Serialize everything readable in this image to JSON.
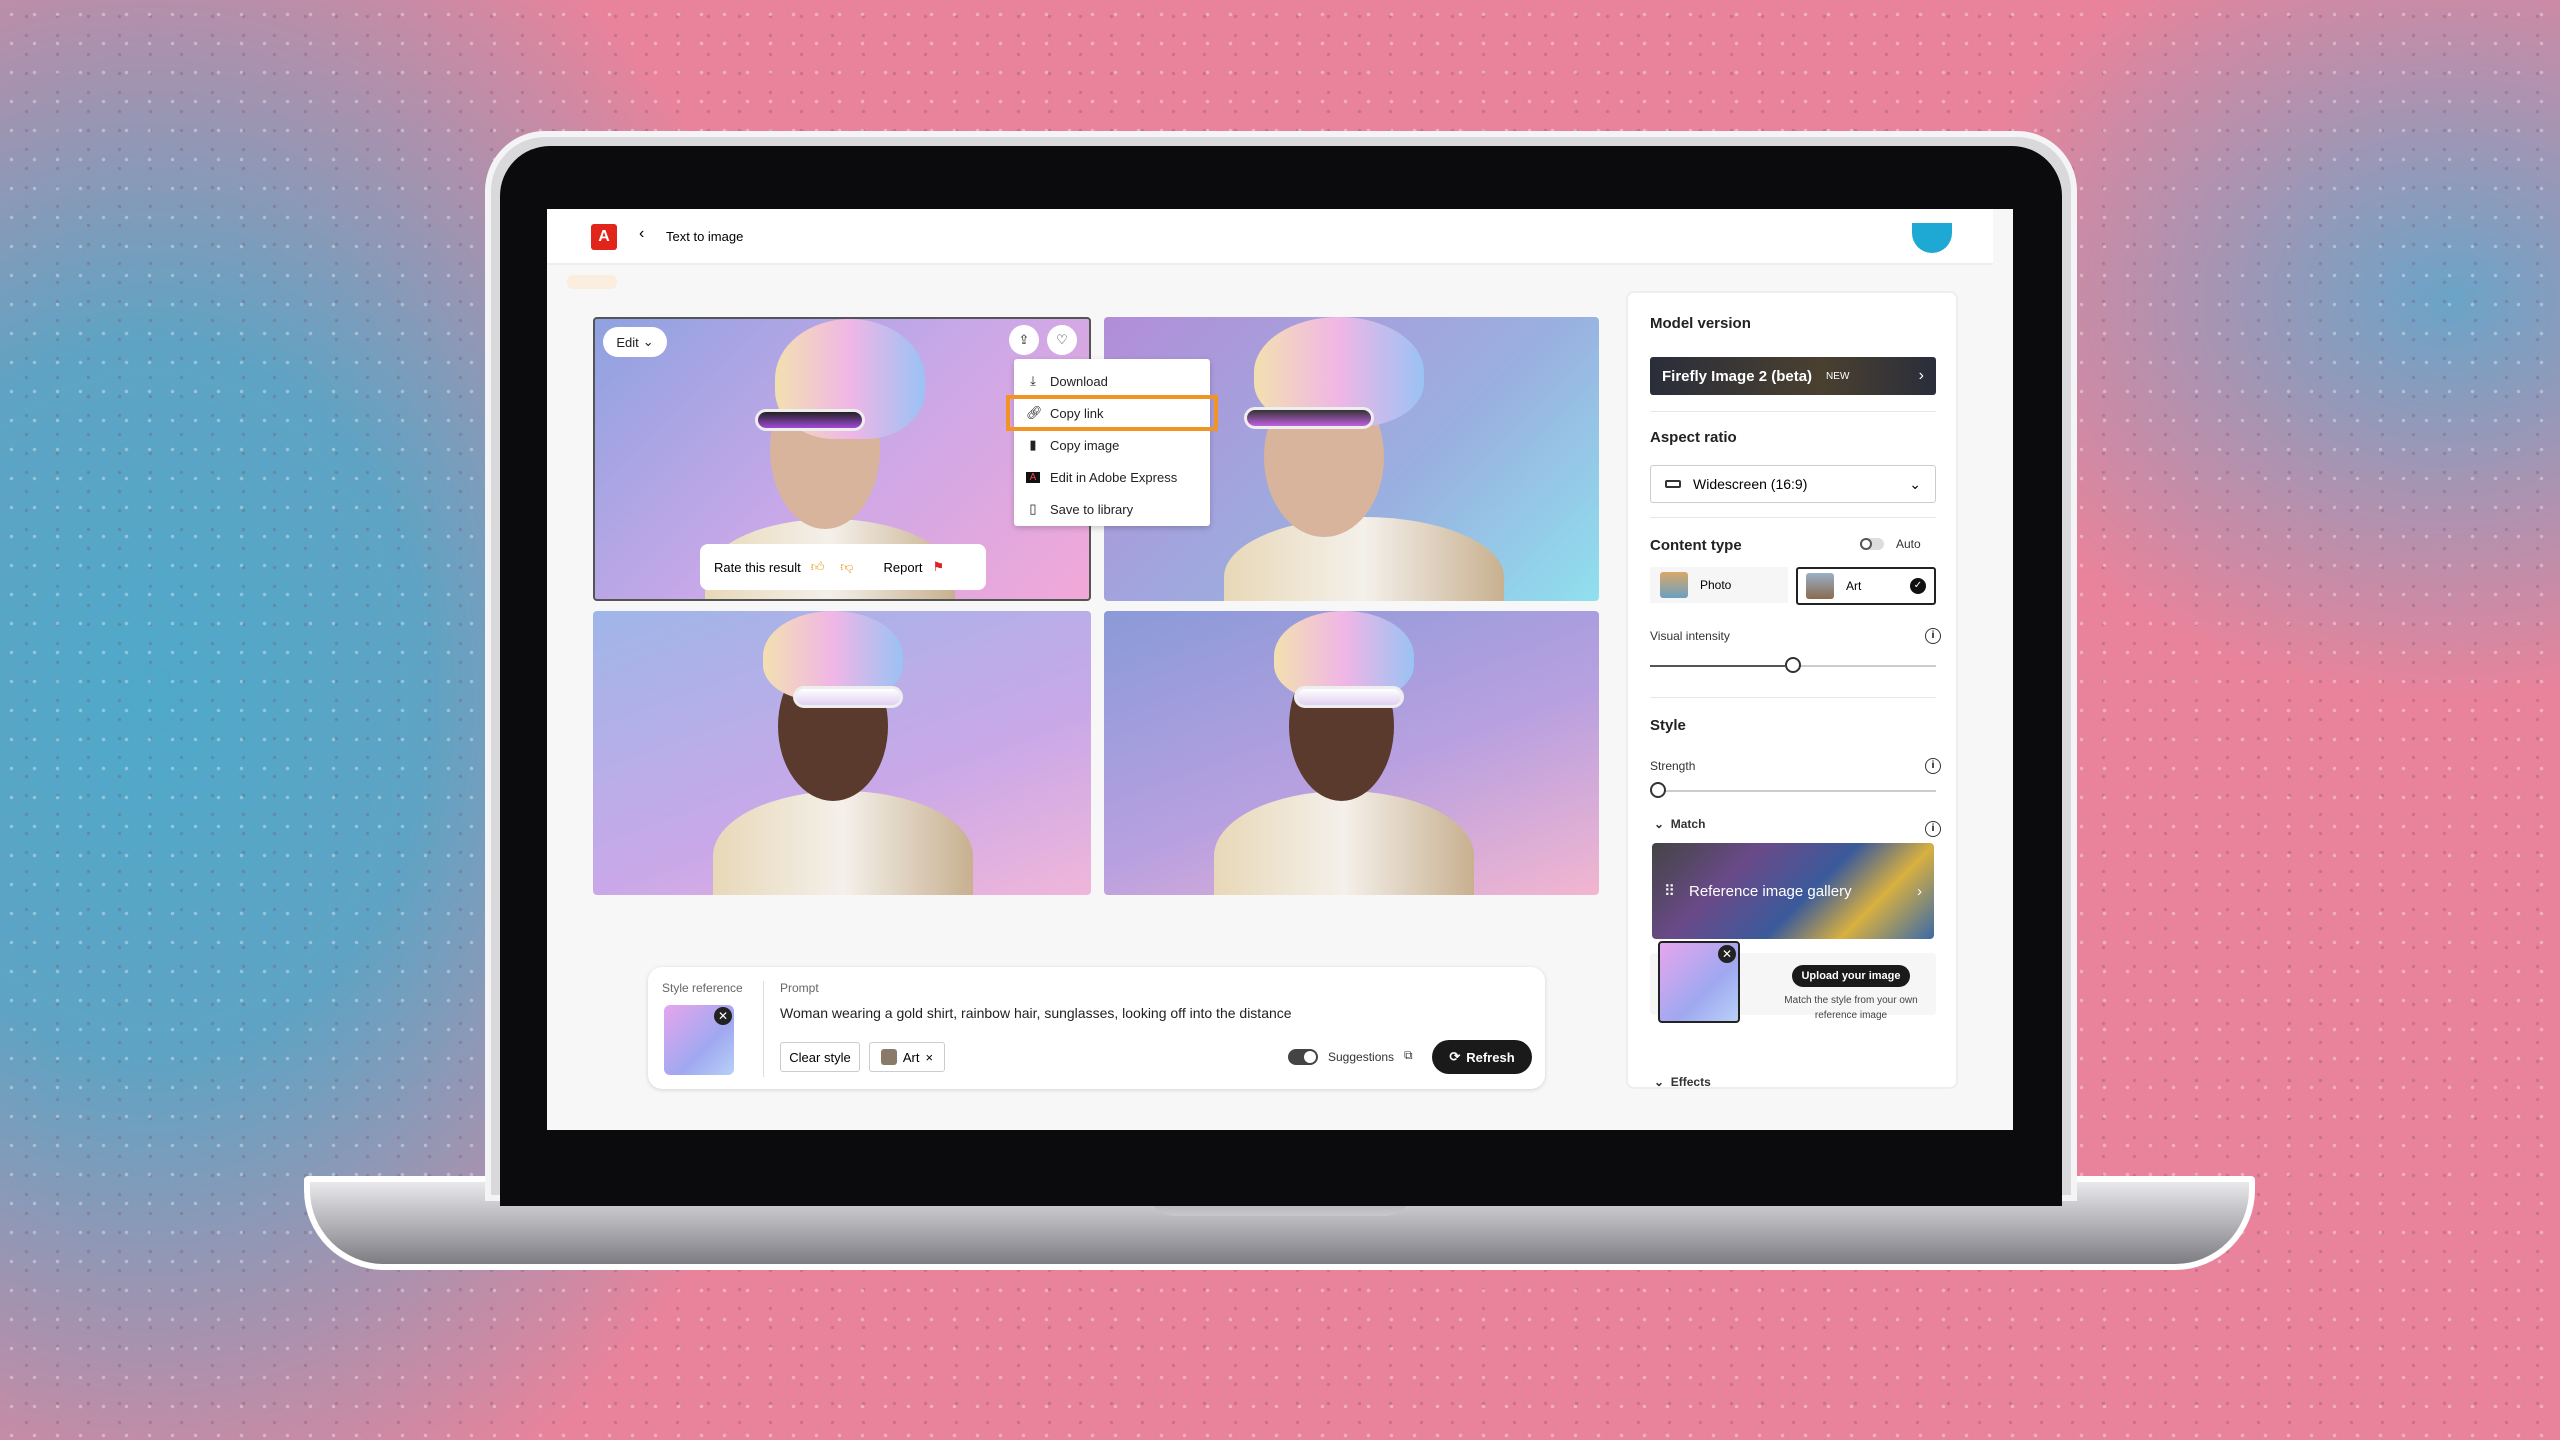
{
  "header": {
    "logo": "A",
    "back_icon": "chevron-left-icon",
    "title": "Text to image"
  },
  "image_card": {
    "edit_label": "Edit",
    "share_icon": "share-icon",
    "favorite_icon": "heart-icon",
    "menu": [
      {
        "label": "Download",
        "icon": "download-icon"
      },
      {
        "label": "Copy link",
        "icon": "link-icon",
        "highlighted": true
      },
      {
        "label": "Copy image",
        "icon": "clipboard-icon"
      },
      {
        "label": "Edit in Adobe Express",
        "icon": "adobe-express-icon"
      },
      {
        "label": "Save to library",
        "icon": "library-icon"
      }
    ],
    "rate_label": "Rate this result",
    "report_label": "Report"
  },
  "prompt": {
    "style_reference_label": "Style reference",
    "prompt_label": "Prompt",
    "text": "Woman wearing a gold shirt, rainbow hair, sunglasses, looking off into the distance",
    "clear_style": "Clear style",
    "art_chip": "Art",
    "suggestions_label": "Suggestions",
    "suggestions_on": true,
    "refresh_label": "Refresh"
  },
  "panel": {
    "model_version_title": "Model version",
    "model": "Firefly Image 2 (beta)",
    "model_badge": "NEW",
    "aspect_ratio_title": "Aspect ratio",
    "aspect_ratio": "Widescreen (16:9)",
    "content_type_title": "Content type",
    "auto_label": "Auto",
    "auto_on": false,
    "photo_label": "Photo",
    "art_label": "Art",
    "selected": "Art",
    "visual_intensity_label": "Visual intensity",
    "visual_intensity": 0.5,
    "style_title": "Style",
    "strength_label": "Strength",
    "strength": 0,
    "match_label": "Match",
    "gallery_label": "Reference image gallery",
    "upload_label": "Upload your image",
    "upload_desc": "Match the style from your own reference image",
    "effects_label": "Effects"
  },
  "colors": {
    "accent": "#e1251b",
    "highlight": "#f29423"
  }
}
